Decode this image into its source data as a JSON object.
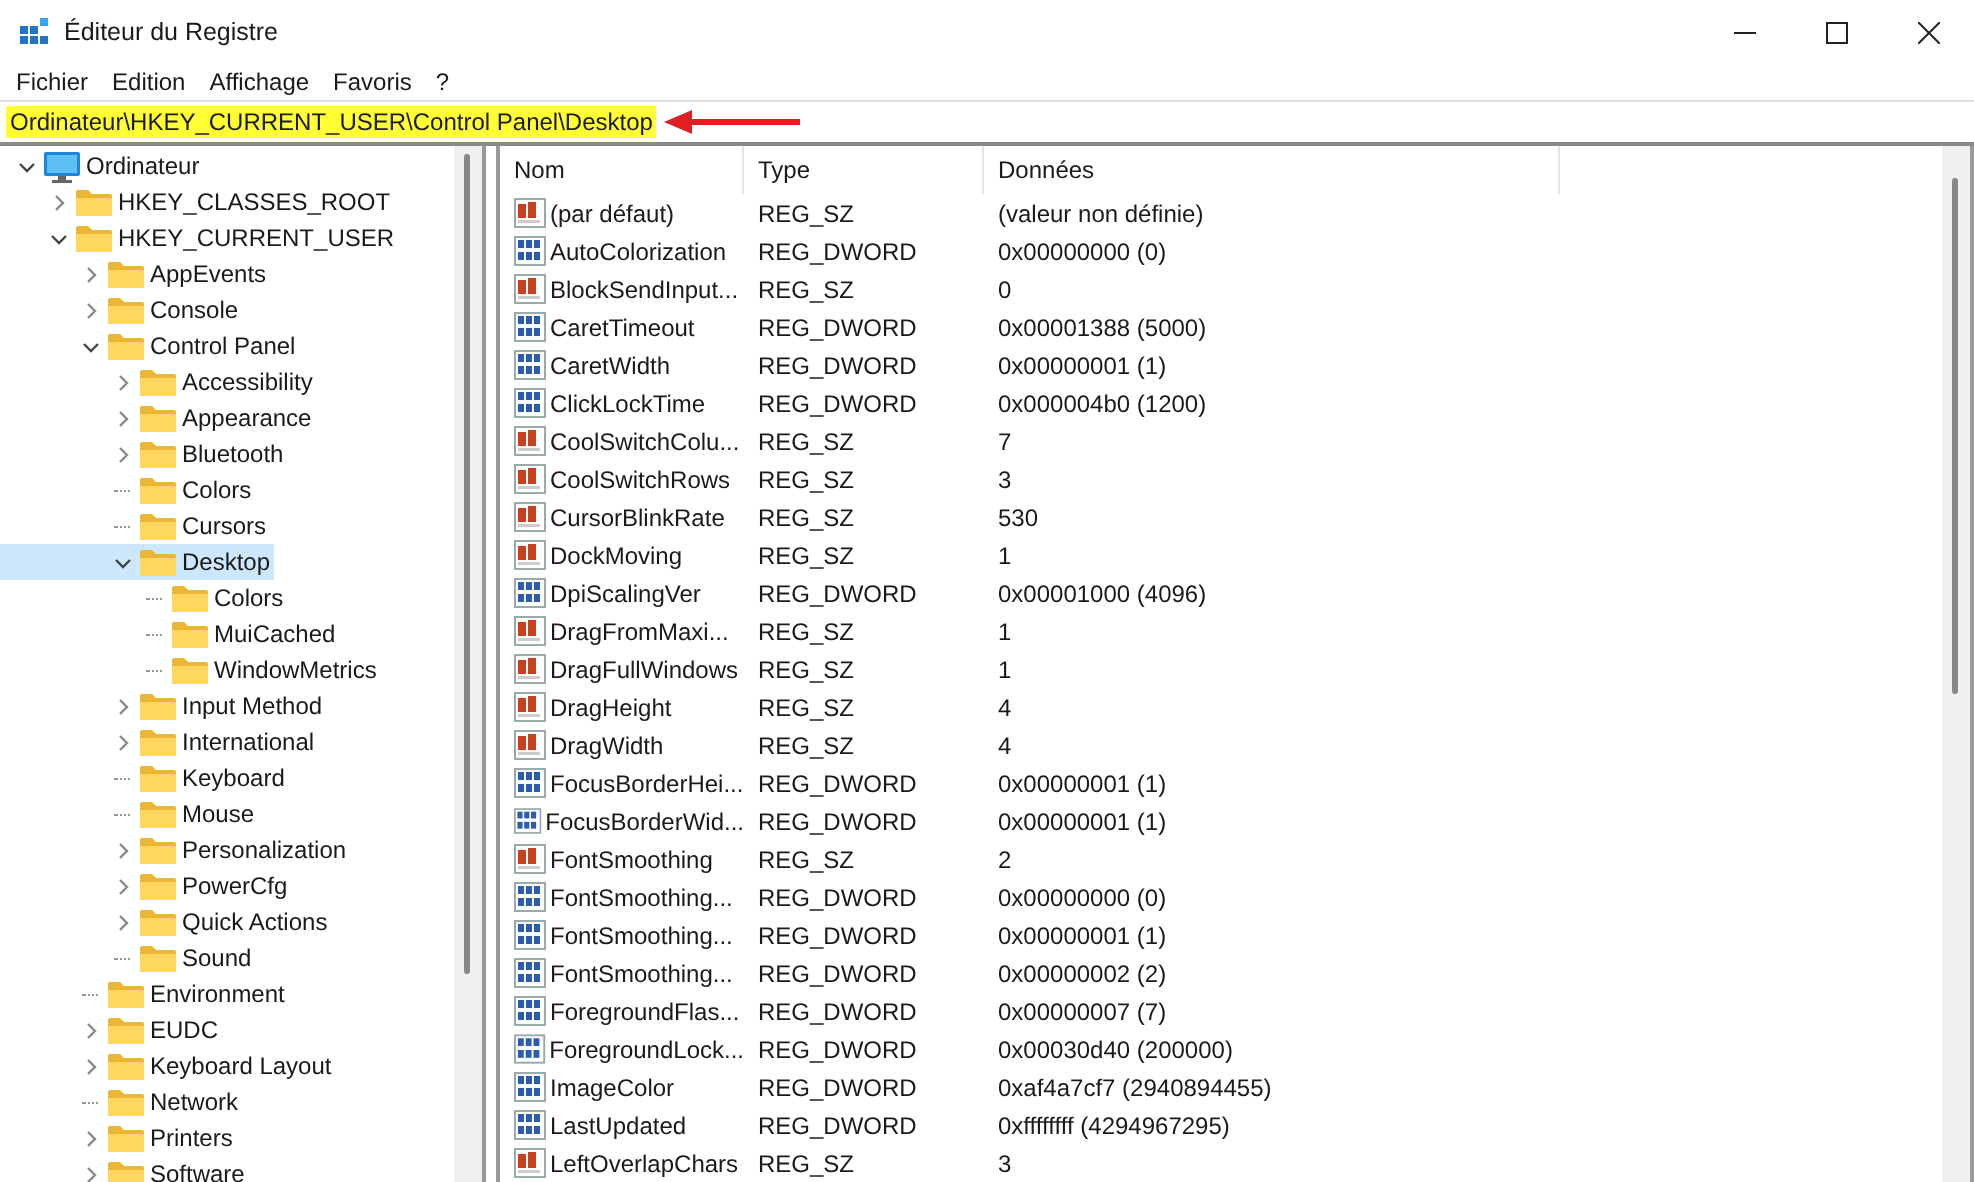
{
  "window": {
    "title": "Éditeur du Registre"
  },
  "menu": [
    "Fichier",
    "Edition",
    "Affichage",
    "Favoris",
    "?"
  ],
  "address": {
    "path": "Ordinateur\\HKEY_CURRENT_USER\\Control Panel\\Desktop",
    "highlighted": true
  },
  "tree": [
    {
      "label": "Ordinateur",
      "kind": "computer",
      "expandable": true,
      "expanded": true,
      "selected": false,
      "children": [
        {
          "label": "HKEY_CLASSES_ROOT",
          "expandable": true,
          "expanded": false,
          "selected": false
        },
        {
          "label": "HKEY_CURRENT_USER",
          "expandable": true,
          "expanded": true,
          "selected": false,
          "children": [
            {
              "label": "AppEvents",
              "expandable": true,
              "expanded": false,
              "selected": false
            },
            {
              "label": "Console",
              "expandable": true,
              "expanded": false,
              "selected": false
            },
            {
              "label": "Control Panel",
              "expandable": true,
              "expanded": true,
              "selected": false,
              "children": [
                {
                  "label": "Accessibility",
                  "expandable": true,
                  "expanded": false,
                  "selected": false
                },
                {
                  "label": "Appearance",
                  "expandable": true,
                  "expanded": false,
                  "selected": false
                },
                {
                  "label": "Bluetooth",
                  "expandable": true,
                  "expanded": false,
                  "selected": false
                },
                {
                  "label": "Colors",
                  "expandable": false,
                  "selected": false
                },
                {
                  "label": "Cursors",
                  "expandable": false,
                  "selected": false
                },
                {
                  "label": "Desktop",
                  "expandable": true,
                  "expanded": true,
                  "selected": true,
                  "children": [
                    {
                      "label": "Colors",
                      "expandable": false,
                      "selected": false
                    },
                    {
                      "label": "MuiCached",
                      "expandable": false,
                      "selected": false
                    },
                    {
                      "label": "WindowMetrics",
                      "expandable": false,
                      "selected": false
                    }
                  ]
                },
                {
                  "label": "Input Method",
                  "expandable": true,
                  "expanded": false,
                  "selected": false
                },
                {
                  "label": "International",
                  "expandable": true,
                  "expanded": false,
                  "selected": false
                },
                {
                  "label": "Keyboard",
                  "expandable": false,
                  "selected": false
                },
                {
                  "label": "Mouse",
                  "expandable": false,
                  "selected": false
                },
                {
                  "label": "Personalization",
                  "expandable": true,
                  "expanded": false,
                  "selected": false
                },
                {
                  "label": "PowerCfg",
                  "expandable": true,
                  "expanded": false,
                  "selected": false
                },
                {
                  "label": "Quick Actions",
                  "expandable": true,
                  "expanded": false,
                  "selected": false
                },
                {
                  "label": "Sound",
                  "expandable": false,
                  "selected": false
                }
              ]
            },
            {
              "label": "Environment",
              "expandable": false,
              "selected": false
            },
            {
              "label": "EUDC",
              "expandable": true,
              "expanded": false,
              "selected": false
            },
            {
              "label": "Keyboard Layout",
              "expandable": true,
              "expanded": false,
              "selected": false
            },
            {
              "label": "Network",
              "expandable": false,
              "selected": false
            },
            {
              "label": "Printers",
              "expandable": true,
              "expanded": false,
              "selected": false
            },
            {
              "label": "Software",
              "expandable": true,
              "expanded": false,
              "selected": false
            }
          ]
        }
      ]
    }
  ],
  "table": {
    "columns": [
      "Nom",
      "Type",
      "Données"
    ],
    "rows": [
      {
        "kind": "sz",
        "name": "(par défaut)",
        "type": "REG_SZ",
        "data": "(valeur non définie)"
      },
      {
        "kind": "dword",
        "name": "AutoColorization",
        "type": "REG_DWORD",
        "data": "0x00000000 (0)"
      },
      {
        "kind": "sz",
        "name": "BlockSendInput...",
        "type": "REG_SZ",
        "data": "0"
      },
      {
        "kind": "dword",
        "name": "CaretTimeout",
        "type": "REG_DWORD",
        "data": "0x00001388 (5000)"
      },
      {
        "kind": "dword",
        "name": "CaretWidth",
        "type": "REG_DWORD",
        "data": "0x00000001 (1)"
      },
      {
        "kind": "dword",
        "name": "ClickLockTime",
        "type": "REG_DWORD",
        "data": "0x000004b0 (1200)"
      },
      {
        "kind": "sz",
        "name": "CoolSwitchColu...",
        "type": "REG_SZ",
        "data": "7"
      },
      {
        "kind": "sz",
        "name": "CoolSwitchRows",
        "type": "REG_SZ",
        "data": "3"
      },
      {
        "kind": "sz",
        "name": "CursorBlinkRate",
        "type": "REG_SZ",
        "data": "530"
      },
      {
        "kind": "sz",
        "name": "DockMoving",
        "type": "REG_SZ",
        "data": "1"
      },
      {
        "kind": "dword",
        "name": "DpiScalingVer",
        "type": "REG_DWORD",
        "data": "0x00001000 (4096)"
      },
      {
        "kind": "sz",
        "name": "DragFromMaxi...",
        "type": "REG_SZ",
        "data": "1"
      },
      {
        "kind": "sz",
        "name": "DragFullWindows",
        "type": "REG_SZ",
        "data": "1"
      },
      {
        "kind": "sz",
        "name": "DragHeight",
        "type": "REG_SZ",
        "data": "4"
      },
      {
        "kind": "sz",
        "name": "DragWidth",
        "type": "REG_SZ",
        "data": "4"
      },
      {
        "kind": "dword",
        "name": "FocusBorderHei...",
        "type": "REG_DWORD",
        "data": "0x00000001 (1)"
      },
      {
        "kind": "dword",
        "name": "FocusBorderWid...",
        "type": "REG_DWORD",
        "data": "0x00000001 (1)"
      },
      {
        "kind": "sz",
        "name": "FontSmoothing",
        "type": "REG_SZ",
        "data": "2"
      },
      {
        "kind": "dword",
        "name": "FontSmoothing...",
        "type": "REG_DWORD",
        "data": "0x00000000 (0)"
      },
      {
        "kind": "dword",
        "name": "FontSmoothing...",
        "type": "REG_DWORD",
        "data": "0x00000001 (1)"
      },
      {
        "kind": "dword",
        "name": "FontSmoothing...",
        "type": "REG_DWORD",
        "data": "0x00000002 (2)"
      },
      {
        "kind": "dword",
        "name": "ForegroundFlas...",
        "type": "REG_DWORD",
        "data": "0x00000007 (7)"
      },
      {
        "kind": "dword",
        "name": "ForegroundLock...",
        "type": "REG_DWORD",
        "data": "0x00030d40 (200000)"
      },
      {
        "kind": "dword",
        "name": "ImageColor",
        "type": "REG_DWORD",
        "data": "0xaf4a7cf7 (2940894455)"
      },
      {
        "kind": "dword",
        "name": "LastUpdated",
        "type": "REG_DWORD",
        "data": "0xffffffff (4294967295)"
      },
      {
        "kind": "sz",
        "name": "LeftOverlapChars",
        "type": "REG_SZ",
        "data": "3"
      }
    ]
  }
}
